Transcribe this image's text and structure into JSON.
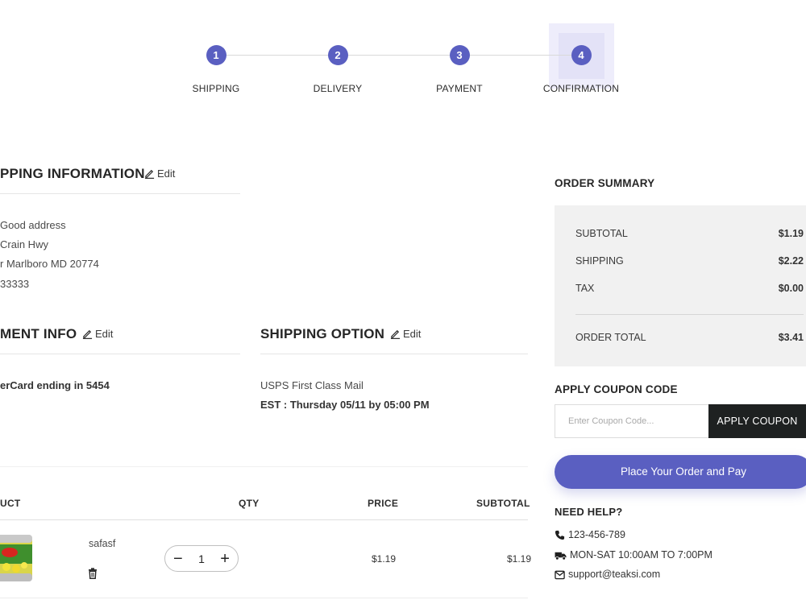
{
  "stepper": {
    "steps": [
      {
        "number": "1",
        "label": "SHIPPING"
      },
      {
        "number": "2",
        "label": "DELIVERY"
      },
      {
        "number": "3",
        "label": "PAYMENT"
      },
      {
        "number": "4",
        "label": "CONFIRMATION"
      }
    ],
    "active_step": "4"
  },
  "shipping_info": {
    "title": "PPING INFORMATION",
    "edit_label": "Edit",
    "address_lines": [
      "Good address",
      "Crain Hwy",
      "r Marlboro MD 20774",
      "33333"
    ]
  },
  "payment_info": {
    "title": "MENT INFO",
    "edit_label": "Edit",
    "card": "erCard ending in 5454"
  },
  "shipping_option": {
    "title": "SHIPPING OPTION",
    "edit_label": "Edit",
    "method": "USPS First Class Mail",
    "estimate": "EST : Thursday 05/11 by 05:00 PM"
  },
  "cart": {
    "headers": {
      "product": "UCT",
      "qty": "QTY",
      "price": "PRICE",
      "subtotal": "SUBTOTAL"
    },
    "items": [
      {
        "name": "safasf",
        "quantity": "1",
        "price": "$1.19",
        "subtotal": "$1.19"
      }
    ]
  },
  "order_summary": {
    "title": "ORDER SUMMARY",
    "rows": [
      {
        "label": "SUBTOTAL",
        "value": "$1.19"
      },
      {
        "label": "SHIPPING",
        "value": "$2.22"
      },
      {
        "label": "TAX",
        "value": "$0.00"
      }
    ],
    "total_label": "ORDER TOTAL",
    "total_value": "$3.41"
  },
  "coupon": {
    "title": "APPLY COUPON CODE",
    "placeholder": "Enter Coupon Code...",
    "button_label": "APPLY COUPON"
  },
  "place_order": {
    "label": "Place Your Order and Pay"
  },
  "help": {
    "title": "NEED HELP?",
    "phone": "123-456-789",
    "hours": "MON-SAT 10:00AM TO 7:00PM",
    "email": "support@teaksi.com"
  },
  "colors": {
    "accent": "#5a5fc1",
    "dark_button": "#1e2121",
    "summary_bg": "#f1f1f1"
  },
  "icons": [
    "edit-icon",
    "trash-icon",
    "minus-icon",
    "plus-icon",
    "phone-icon",
    "truck-icon",
    "email-icon"
  ]
}
